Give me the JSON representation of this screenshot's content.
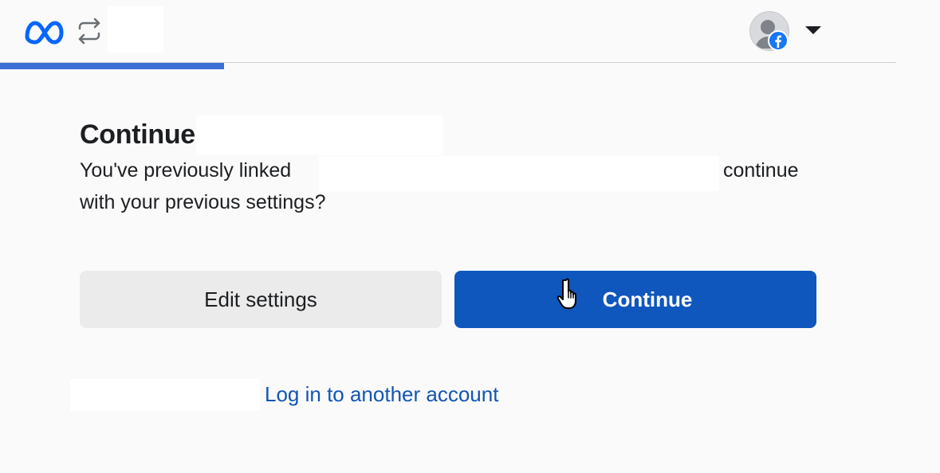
{
  "header": {
    "logo": "meta-logo-icon",
    "sync_icon": "sync-arrows-icon",
    "account_icon": "user-avatar-icon",
    "badge_icon": "facebook-badge-icon",
    "menu_icon": "caret-down-icon"
  },
  "progress": {
    "fraction": 0.25,
    "color": "#3b6fd6"
  },
  "dialog": {
    "title": "Continue",
    "body_start": "You've previously linked ",
    "body_end": "continue",
    "body_line2": "with your previous settings?",
    "edit_button_label": "Edit settings",
    "continue_button_label": "Continue",
    "other_account_link": "Log in to another account"
  },
  "colors": {
    "primary_button": "#0f56bd",
    "secondary_button": "#ebebeb",
    "link": "#1155b5"
  }
}
